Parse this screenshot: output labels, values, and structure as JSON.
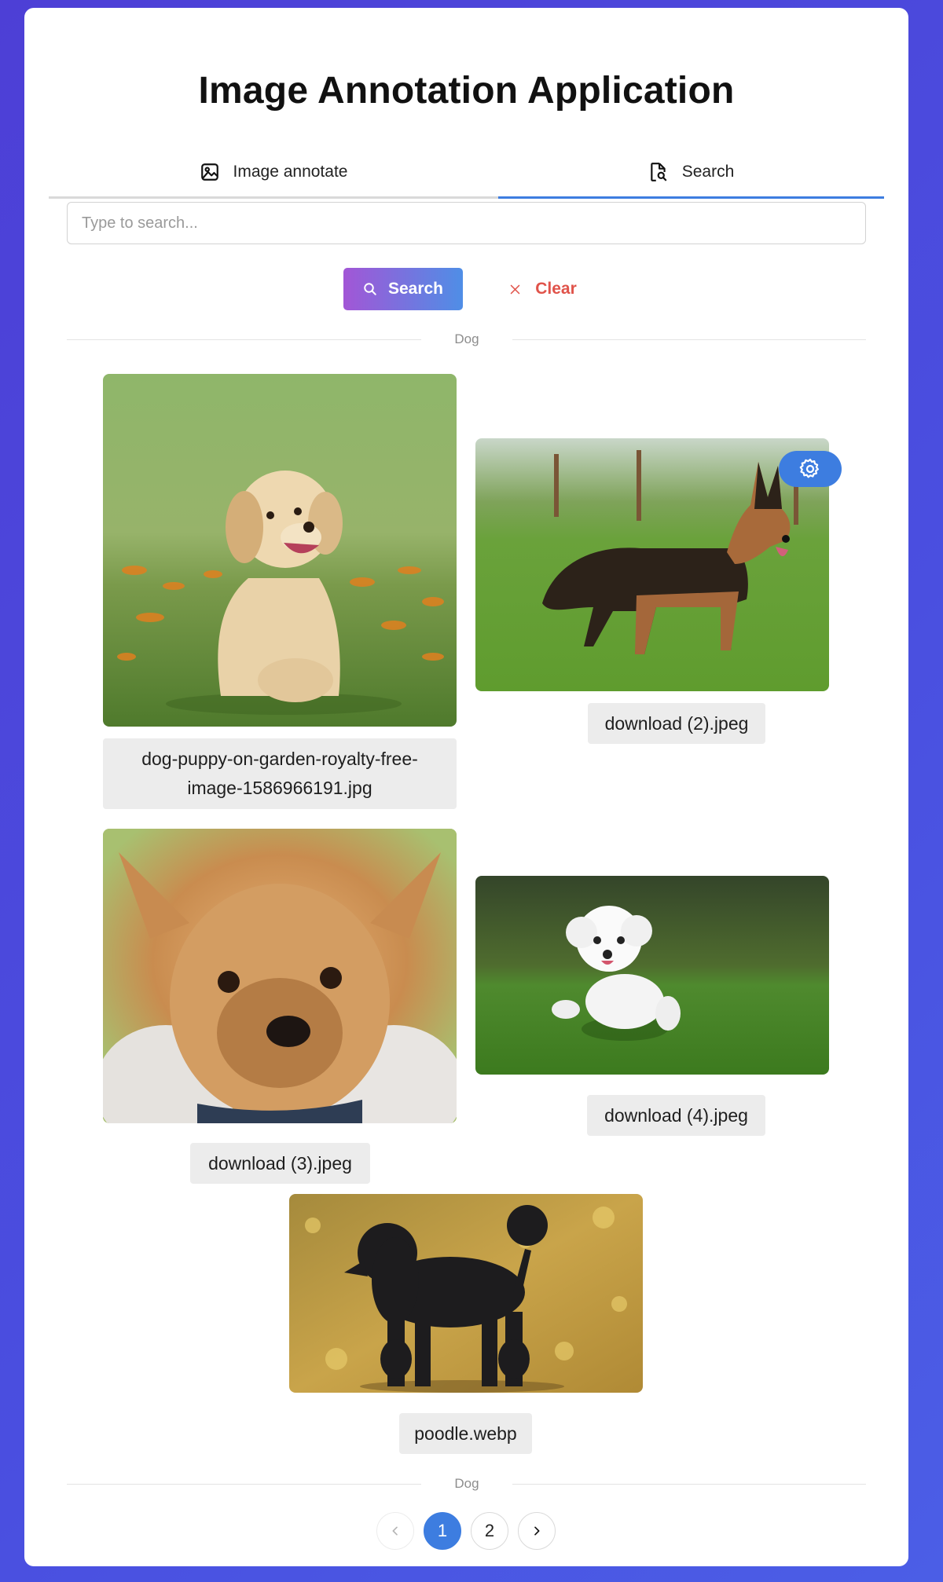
{
  "app": {
    "title": "Image Annotation Application"
  },
  "tabs": [
    {
      "label": "Image annotate",
      "icon": "image-icon",
      "active": false
    },
    {
      "label": "Search",
      "icon": "file-search-icon",
      "active": true
    }
  ],
  "search": {
    "placeholder": "Type to search...",
    "value": ""
  },
  "buttons": {
    "search_label": "Search",
    "clear_label": "Clear"
  },
  "divider_top": "Dog",
  "divider_bottom": "Dog",
  "results": [
    {
      "filename": "dog-puppy-on-garden-royalty-free-image-1586966191.jpg",
      "line1": "dog-puppy-on-garden-royalty-free-",
      "line2": "image-1586966191.jpg"
    },
    {
      "filename": "download (2).jpeg"
    },
    {
      "filename": "download (3).jpeg"
    },
    {
      "filename": "download (4).jpeg"
    },
    {
      "filename": "poodle.webp"
    }
  ],
  "pagination": {
    "pages": [
      "1",
      "2"
    ],
    "current": "1"
  },
  "colors": {
    "accent": "#3d7de0",
    "danger": "#e0534a",
    "background": "#4b4fe0"
  }
}
